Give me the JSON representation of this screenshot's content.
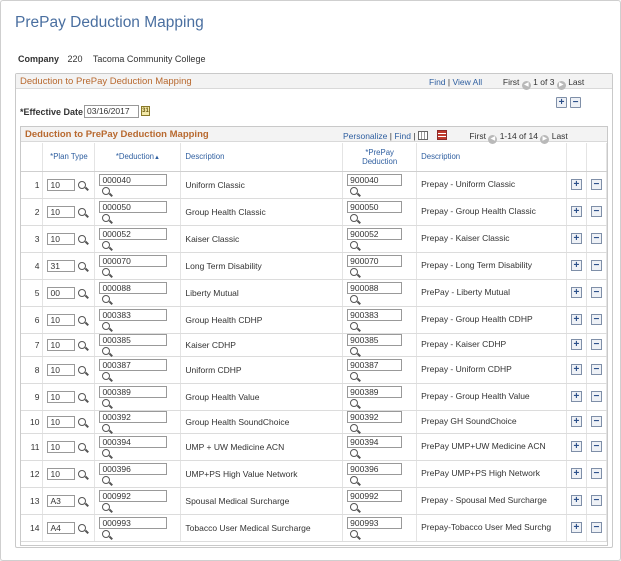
{
  "page": {
    "title": "PrePay Deduction Mapping"
  },
  "company": {
    "label": "Company",
    "code": "220",
    "name": "Tacoma Community College"
  },
  "outer": {
    "title": "Deduction to PrePay Deduction Mapping",
    "find": "Find",
    "separator": "|",
    "view_all": "View All",
    "first": "First",
    "range": "1 of 3",
    "last": "Last"
  },
  "effective": {
    "label": "*Effective Date",
    "value": "03/16/2017",
    "calendar_glyph": "31"
  },
  "grid": {
    "title": "Deduction to PrePay Deduction Mapping",
    "personalize": "Personalize",
    "separator": "|",
    "find": "Find",
    "first": "First",
    "range": "1-14 of 14",
    "last": "Last",
    "headers": {
      "plan_type": "*Plan Type",
      "deduction": "*Deduction",
      "description": "Description",
      "prepay_deduction_line1": "*PrePay",
      "prepay_deduction_line2": "Deduction",
      "prepay_description": "Description"
    },
    "add_glyph": "+",
    "remove_glyph": "−",
    "rows": [
      {
        "num": "1",
        "plan": "10",
        "ded": "000040",
        "desc": "Uniform Classic",
        "pp": "900040",
        "ppdesc": "Prepay - Uniform Classic"
      },
      {
        "num": "2",
        "plan": "10",
        "ded": "000050",
        "desc": "Group Health Classic",
        "pp": "900050",
        "ppdesc": "Prepay - Group Health Classic"
      },
      {
        "num": "3",
        "plan": "10",
        "ded": "000052",
        "desc": "Kaiser Classic",
        "pp": "900052",
        "ppdesc": "Prepay - Kaiser Classic"
      },
      {
        "num": "4",
        "plan": "31",
        "ded": "000070",
        "desc": "Long Term Disability",
        "pp": "900070",
        "ppdesc": "Prepay - Long Term Disability"
      },
      {
        "num": "5",
        "plan": "00",
        "ded": "000088",
        "desc": "Liberty Mutual",
        "pp": "900088",
        "ppdesc": "PrePay - Liberty Mutual"
      },
      {
        "num": "6",
        "plan": "10",
        "ded": "000383",
        "desc": "Group Health CDHP",
        "pp": "900383",
        "ppdesc": "Prepay - Group Health CDHP"
      },
      {
        "num": "7",
        "plan": "10",
        "ded": "000385",
        "desc": "Kaiser CDHP",
        "pp": "900385",
        "ppdesc": "Prepay - Kaiser CDHP"
      },
      {
        "num": "8",
        "plan": "10",
        "ded": "000387",
        "desc": "Uniform CDHP",
        "pp": "900387",
        "ppdesc": "Prepay - Uniform CDHP"
      },
      {
        "num": "9",
        "plan": "10",
        "ded": "000389",
        "desc": "Group Health Value",
        "pp": "900389",
        "ppdesc": "Prepay - Group Health Value"
      },
      {
        "num": "10",
        "plan": "10",
        "ded": "000392",
        "desc": "Group Health SoundChoice",
        "pp": "900392",
        "ppdesc": "Prepay GH SoundChoice"
      },
      {
        "num": "11",
        "plan": "10",
        "ded": "000394",
        "desc": "UMP + UW Medicine ACN",
        "pp": "900394",
        "ppdesc": "PrePay UMP+UW Medicine ACN"
      },
      {
        "num": "12",
        "plan": "10",
        "ded": "000396",
        "desc": "UMP+PS High Value Network",
        "pp": "900396",
        "ppdesc": "PrePay UMP+PS High Network"
      },
      {
        "num": "13",
        "plan": "A3",
        "ded": "000992",
        "desc": "Spousal Medical Surcharge",
        "pp": "900992",
        "ppdesc": "Prepay - Spousal Med Surcharge"
      },
      {
        "num": "14",
        "plan": "A4",
        "ded": "000993",
        "desc": "Tobacco User Medical Surcharge",
        "pp": "900993",
        "ppdesc": "Prepay-Tobacco User Med Surchg"
      }
    ]
  }
}
